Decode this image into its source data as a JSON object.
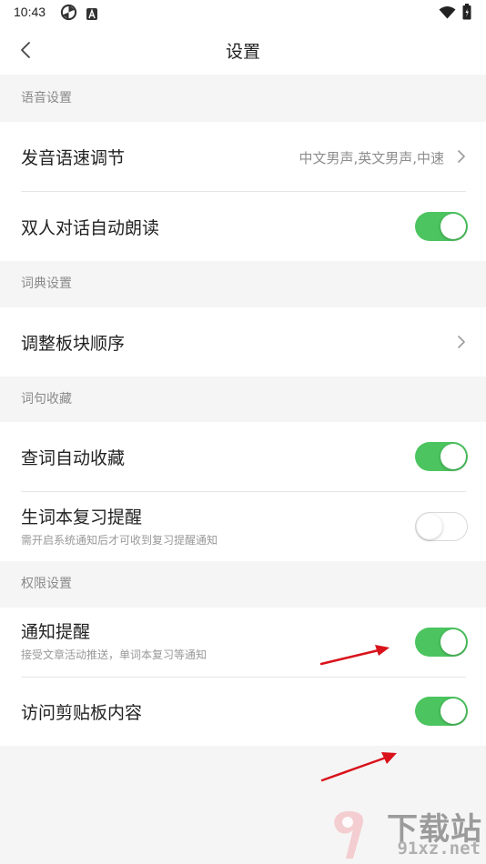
{
  "status_bar": {
    "time": "10:43",
    "icons": [
      "pinwheel-icon",
      "a-badge-icon",
      "wifi-icon",
      "battery-icon"
    ]
  },
  "header": {
    "title": "设置",
    "back_icon": "chevron-left-icon"
  },
  "sections": {
    "voice": {
      "header": "语音设置",
      "pronunciation": {
        "label": "发音语速调节",
        "value": "中文男声,英文男声,中速"
      },
      "dialogue_autoread": {
        "label": "双人对话自动朗读",
        "enabled": true
      }
    },
    "dictionary": {
      "header": "词典设置",
      "module_order": {
        "label": "调整板块顺序"
      }
    },
    "collection": {
      "header": "词句收藏",
      "auto_collect": {
        "label": "查词自动收藏",
        "enabled": true
      },
      "review_reminder": {
        "label": "生词本复习提醒",
        "sublabel": "需开启系统通知后才可收到复习提醒通知",
        "enabled": false
      }
    },
    "permissions": {
      "header": "权限设置",
      "notification": {
        "label": "通知提醒",
        "sublabel": "接受文章活动推送，单词本复习等通知",
        "enabled": true
      },
      "clipboard": {
        "label": "访问剪贴板内容",
        "enabled": true
      }
    }
  },
  "colors": {
    "toggle_on": "#4cc45f",
    "annotation_arrow": "#d9121b",
    "background": "#f5f5f5"
  },
  "watermark": {
    "main": "下载站",
    "sub": "91xz.net",
    "logo_glyph": "9"
  }
}
